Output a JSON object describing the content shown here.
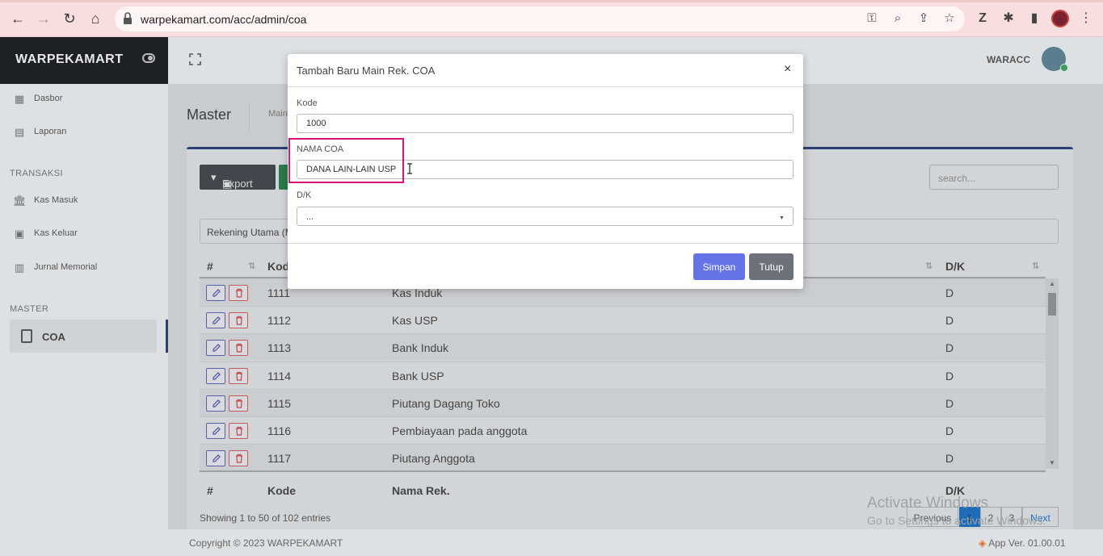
{
  "browser": {
    "url": "warpekamart.com/acc/admin/coa"
  },
  "brand": {
    "name": "WARPEKAMART"
  },
  "sidebar": {
    "items_top": [
      {
        "label": "Dasbor",
        "icon": "grid-icon"
      },
      {
        "label": "Laporan",
        "icon": "clipboard-icon"
      }
    ],
    "section_transaksi": "TRANSAKSI",
    "items_transaksi": [
      {
        "label": "Kas Masuk",
        "icon": "bank-icon"
      },
      {
        "label": "Kas Keluar",
        "icon": "cash-icon"
      },
      {
        "label": "Jurnal Memorial",
        "icon": "book-icon"
      }
    ],
    "section_master": "MASTER",
    "active_item": "COA"
  },
  "header": {
    "user": "WARACC"
  },
  "page": {
    "title": "Master",
    "breadcrumb": "Main",
    "export_label": "Export",
    "search_placeholder": "search...",
    "filter_value": "Rekening Utama (M"
  },
  "table": {
    "headers": {
      "num": "#",
      "kode": "Kode",
      "nama": "Nama Rek.",
      "dk": "D/K"
    },
    "header_kode_visible": "Kod",
    "rows": [
      {
        "kode": "1111",
        "nama": "Kas Induk",
        "dk": "D"
      },
      {
        "kode": "1112",
        "nama": "Kas USP",
        "dk": "D"
      },
      {
        "kode": "1113",
        "nama": "Bank Induk",
        "dk": "D"
      },
      {
        "kode": "1114",
        "nama": "Bank USP",
        "dk": "D"
      },
      {
        "kode": "1115",
        "nama": "Piutang Dagang Toko",
        "dk": "D"
      },
      {
        "kode": "1116",
        "nama": "Pembiayaan pada anggota",
        "dk": "D"
      },
      {
        "kode": "1117",
        "nama": "Piutang Anggota",
        "dk": "D"
      }
    ],
    "showing": "Showing 1 to 50 of 102 entries",
    "pagination": {
      "previous": "Previous",
      "pages": [
        "1",
        "2",
        "3"
      ],
      "next": "Next"
    }
  },
  "footer": {
    "copyright": "Copyright © 2023 WARPEKAMART",
    "version": "App Ver. 01.00.01"
  },
  "watermark": {
    "line1": "Activate Windows",
    "line2": "Go to Settings to activate Windows."
  },
  "modal": {
    "title": "Tambah Baru Main Rek. COA",
    "close": "×",
    "kode_label": "Kode",
    "kode_value": "1000",
    "nama_label": "NAMA COA",
    "nama_value": "DANA LAIN-LAIN USP",
    "dk_label": "D/K",
    "dk_value": "...",
    "save_label": "Simpan",
    "close_label": "Tutup"
  }
}
